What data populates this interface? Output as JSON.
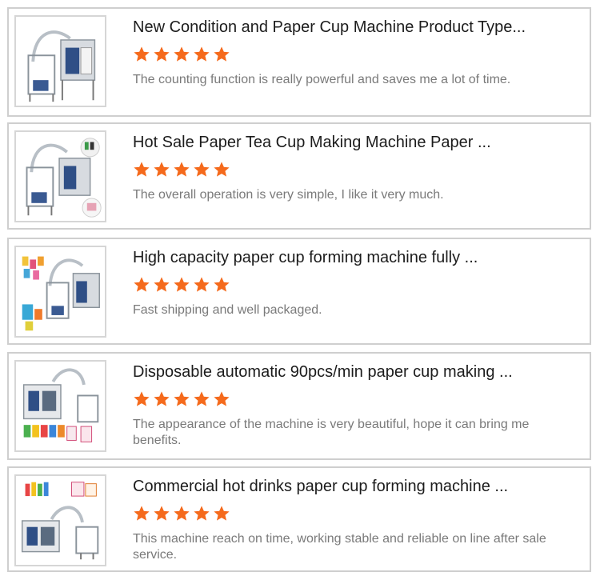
{
  "colors": {
    "star": "#f56a1c",
    "title_text": "#1c1c1c",
    "comment_text": "#7a7a7a",
    "card_border": "#cfcfcf"
  },
  "reviews": [
    {
      "title": "New Condition and Paper Cup Machine Product Type...",
      "rating": 5,
      "comment": "The counting function is really powerful and saves me a lot of time.",
      "image_icon": "paper-cup-machine-image"
    },
    {
      "title": "Hot Sale Paper Tea Cup Making Machine Paper ...",
      "rating": 5,
      "comment": "The overall operation is very simple, I like it very much.",
      "image_icon": "paper-cup-machine-image"
    },
    {
      "title": "High capacity paper cup forming machine fully ...",
      "rating": 5,
      "comment": "Fast shipping and well packaged.",
      "image_icon": "paper-cup-machine-image"
    },
    {
      "title": "Disposable automatic 90pcs/min paper cup making ...",
      "rating": 5,
      "comment": "The appearance of the machine is very beautiful, hope it can bring me benefits.",
      "image_icon": "paper-cup-machine-image"
    },
    {
      "title": "Commercial hot drinks paper cup forming machine ...",
      "rating": 5,
      "comment": "This machine reach on time, working stable and reliable on line after sale service.",
      "image_icon": "paper-cup-machine-image"
    }
  ]
}
